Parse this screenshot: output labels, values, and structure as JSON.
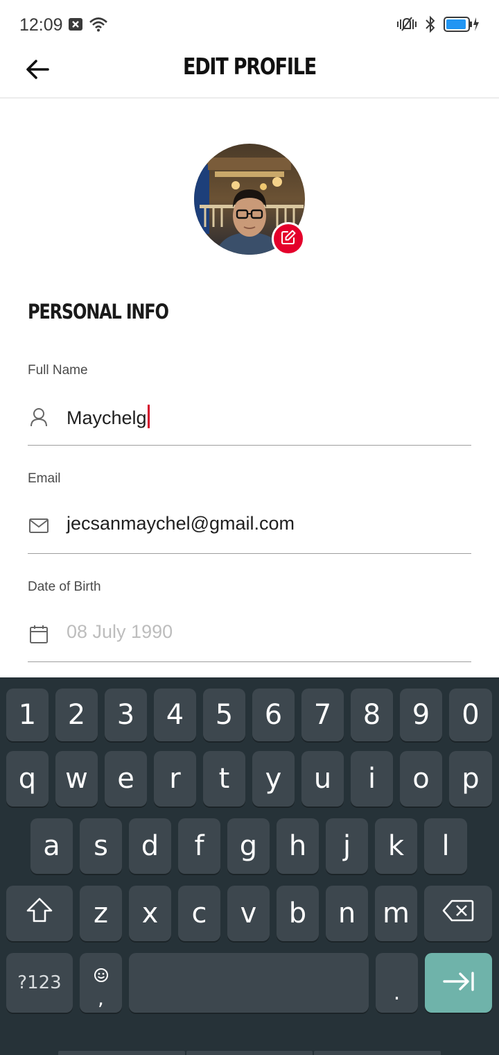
{
  "status_bar": {
    "time": "12:09",
    "left_icons": [
      "notification-x-icon",
      "wifi-icon"
    ],
    "right_icons": [
      "vibrate-mute-icon",
      "bluetooth-icon",
      "battery-charging-icon"
    ]
  },
  "app_bar": {
    "back_icon": "arrow-left-icon",
    "title": "EDIT PROFILE"
  },
  "avatar": {
    "edit_icon": "edit-pencil-icon",
    "edit_color": "#e4002b"
  },
  "personal_info": {
    "section_title": "PERSONAL INFO",
    "full_name": {
      "label": "Full Name",
      "value": "Maychelg",
      "icon": "person-icon"
    },
    "email": {
      "label": "Email",
      "value": "jecsanmaychel@gmail.com",
      "icon": "mail-icon"
    },
    "dob": {
      "label": "Date of Birth",
      "placeholder": "08 July 1990",
      "icon": "calendar-icon"
    }
  },
  "keyboard": {
    "digits": [
      "1",
      "2",
      "3",
      "4",
      "5",
      "6",
      "7",
      "8",
      "9",
      "0"
    ],
    "row1": [
      "q",
      "w",
      "e",
      "r",
      "t",
      "y",
      "u",
      "i",
      "o",
      "p"
    ],
    "row2": [
      "a",
      "s",
      "d",
      "f",
      "g",
      "h",
      "j",
      "k",
      "l"
    ],
    "row3": [
      "z",
      "x",
      "c",
      "v",
      "b",
      "n",
      "m"
    ],
    "symbols_label": "?123",
    "comma_label": ",",
    "period_label": ".",
    "enter_color": "#6fb3aa"
  }
}
